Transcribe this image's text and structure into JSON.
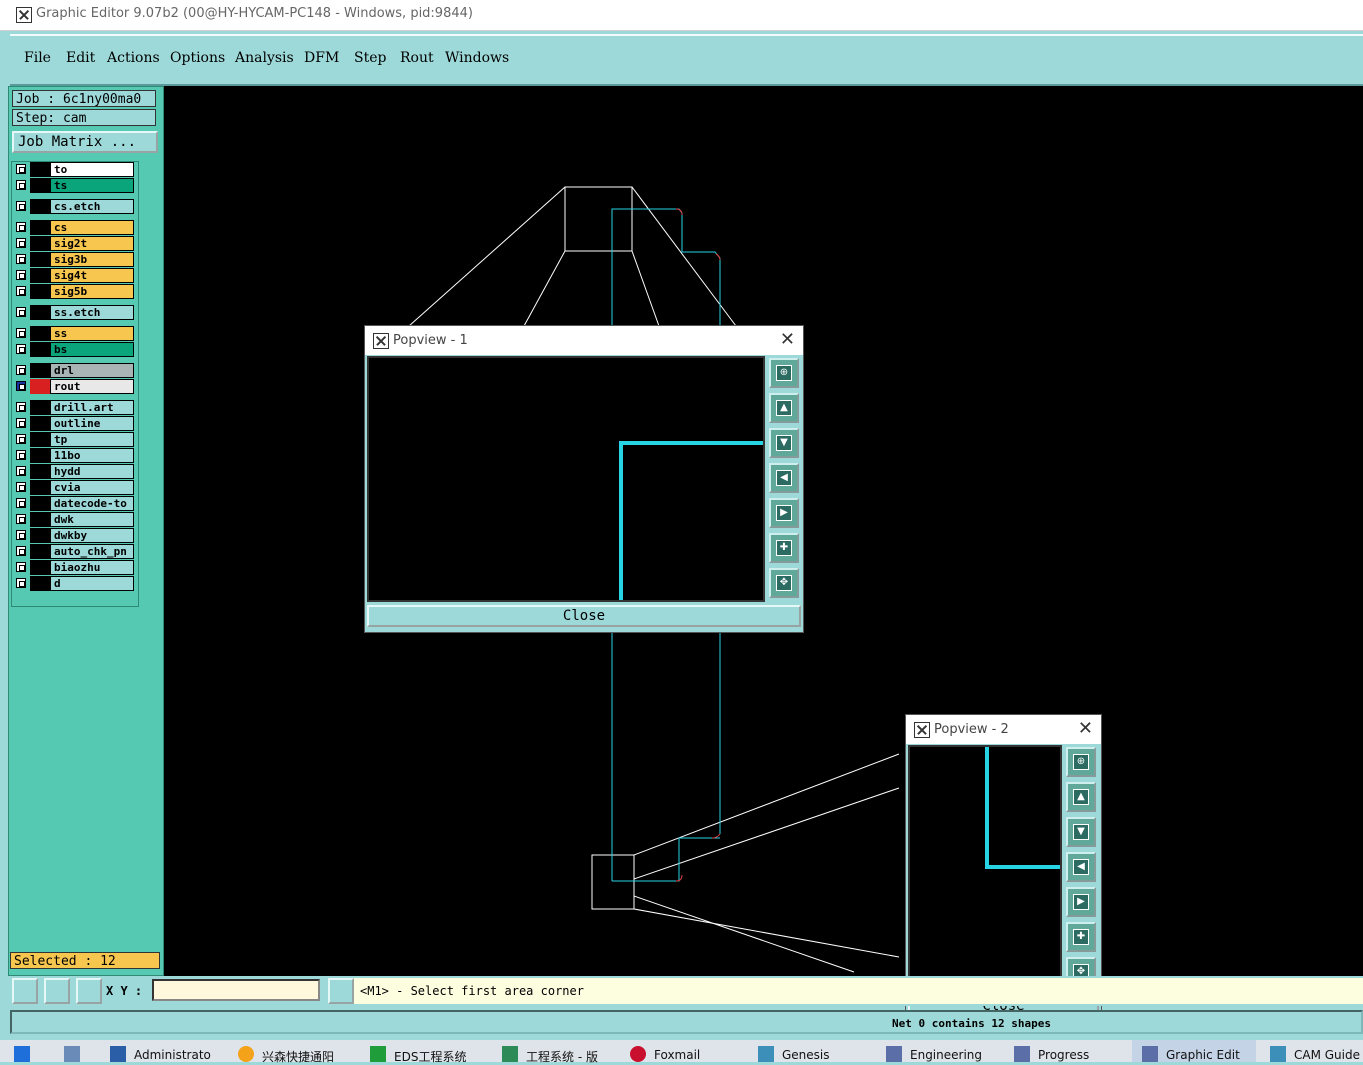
{
  "window": {
    "title": "Graphic Editor 9.07b2 (00@HY-HYCAM-PC148 - Windows, pid:9844)"
  },
  "menu": [
    "File",
    "Edit",
    "Actions",
    "Options",
    "Analysis",
    "DFM",
    "Step",
    "Rout",
    "Windows"
  ],
  "job": {
    "job_label": "Job : 6c1ny00ma0",
    "step_label": "Step: cam",
    "matrix_button": "Job Matrix ..."
  },
  "layers": [
    {
      "name": "to",
      "color": "#ffffff"
    },
    {
      "name": "ts",
      "color": "#0aa57a"
    },
    {
      "name": "cs.etch",
      "color": "#9ed9d9"
    },
    {
      "name": "cs",
      "color": "#f7c64f"
    },
    {
      "name": "sig2t",
      "color": "#f7c64f"
    },
    {
      "name": "sig3b",
      "color": "#f7c64f"
    },
    {
      "name": "sig4t",
      "color": "#f7c64f"
    },
    {
      "name": "sig5b",
      "color": "#f7c64f"
    },
    {
      "name": "ss.etch",
      "color": "#9ed9d9"
    },
    {
      "name": "ss",
      "color": "#f7c64f"
    },
    {
      "name": "bs",
      "color": "#0aa57a"
    },
    {
      "name": "drl",
      "color": "#a9b4b4"
    },
    {
      "name": "rout",
      "color": "#e8e8e8"
    },
    {
      "name": "drill.art",
      "color": "#9ed9d9"
    },
    {
      "name": "outline",
      "color": "#9ed9d9"
    },
    {
      "name": "tp",
      "color": "#9ed9d9"
    },
    {
      "name": "11bo",
      "color": "#9ed9d9"
    },
    {
      "name": "hydd",
      "color": "#9ed9d9"
    },
    {
      "name": "cvia",
      "color": "#9ed9d9"
    },
    {
      "name": "datecode-to",
      "color": "#9ed9d9"
    },
    {
      "name": "dwk",
      "color": "#9ed9d9"
    },
    {
      "name": "dwkby",
      "color": "#9ed9d9"
    },
    {
      "name": "auto_chk_pn",
      "color": "#9ed9d9"
    },
    {
      "name": "biaozhu",
      "color": "#9ed9d9"
    },
    {
      "name": "d",
      "color": "#9ed9d9"
    }
  ],
  "selected": "Selected : 12",
  "xy_label": "X Y :",
  "xy_value": "",
  "prompt": "<M1> - Select first area corner",
  "net_status": "Net 0 contains 12 shapes",
  "popview1": {
    "title": "Popview - 1",
    "close": "Close"
  },
  "popview2": {
    "title": "Popview - 2",
    "close": "Close"
  },
  "taskbar": [
    "Administrato",
    "兴森快捷通阳",
    "EDS工程系统",
    "工程系统 - 版",
    "Foxmail",
    "Genesis",
    "Engineering",
    "Progress",
    "Graphic Edit",
    "CAM Guide"
  ],
  "colors": {
    "accent": "#9ed9d9",
    "panel": "#55c9b1",
    "trace_cyan": "#26d4e6",
    "highlight": "#f7c64f"
  }
}
